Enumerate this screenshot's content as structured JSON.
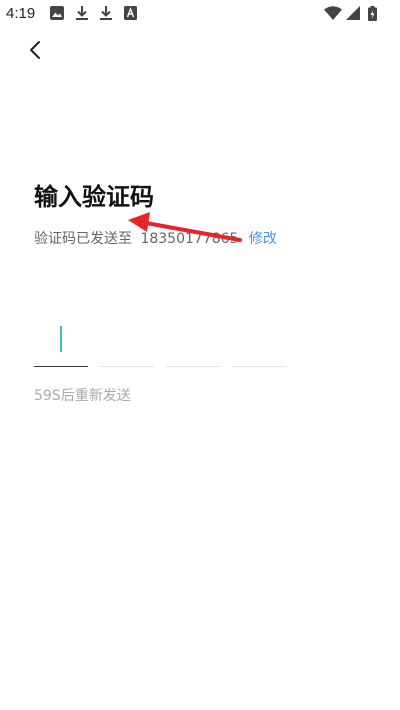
{
  "status_bar": {
    "time": "4:19",
    "left_icons": [
      "image-icon",
      "download-icon",
      "download-icon",
      "font-icon"
    ],
    "right_icons": [
      "wifi-icon",
      "signal-icon",
      "battery-icon"
    ]
  },
  "header": {
    "back_icon": "chevron-left-icon"
  },
  "main": {
    "title": "输入验证码",
    "sent_to_label": "验证码已发送至",
    "phone_number": "18350177865",
    "modify_label": "修改",
    "resend_countdown": "59S后重新发送"
  },
  "colors": {
    "accent": "#4a90e2",
    "cursor": "#3fc0c8",
    "annotation_arrow": "#e8242b"
  }
}
